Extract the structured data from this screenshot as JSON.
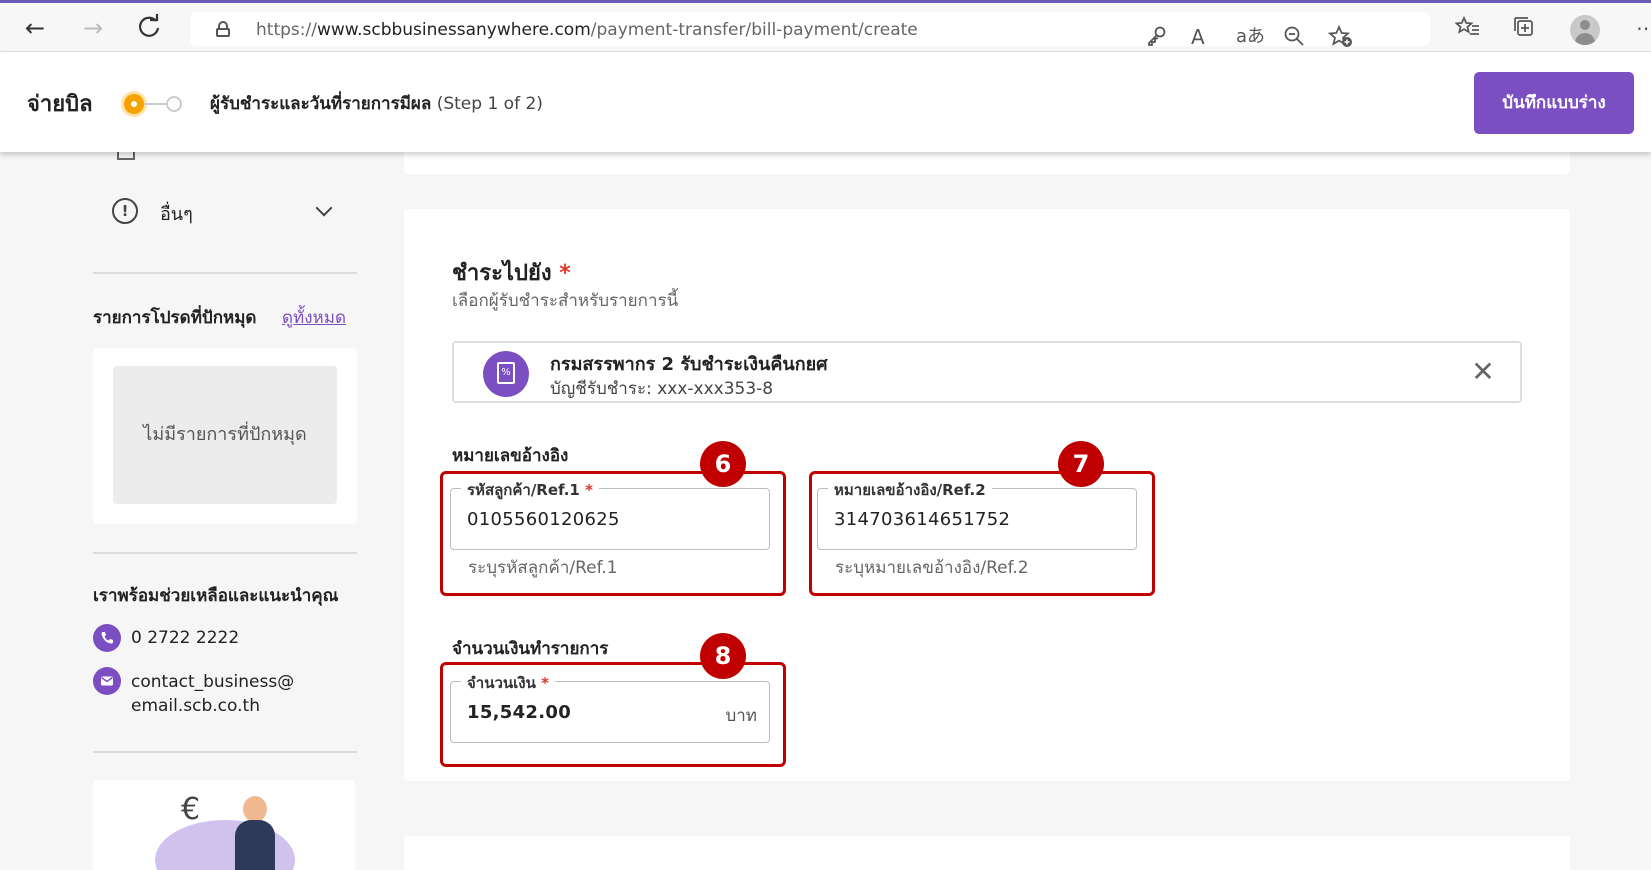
{
  "browser": {
    "back_icon": "←",
    "forward_icon": "→",
    "refresh_icon": "C",
    "url_scheme": "https://",
    "url_host": "www.scbbusinessanywhere.com",
    "url_path": "/payment-transfer/bill-payment/create",
    "icons": [
      "key-icon",
      "read-aloud-icon",
      "translate-icon",
      "zoom-out-icon",
      "favorite-add-icon",
      "favorites-icon",
      "collections-icon",
      "profile-icon",
      "more-icon"
    ],
    "read_aloud_glyph": "A",
    "translate_glyph": "aあ",
    "more_glyph": "⋯"
  },
  "header": {
    "title": "จ่ายบิล",
    "step_label": "ผู้รับชำระและวันที่รายการมีผล",
    "step_count": "(Step 1 of 2)",
    "save_draft": "บันทึกแบบร่าง",
    "step_active_color": "#f5a300",
    "accent_color": "#7b4fc2"
  },
  "sidebar": {
    "more_label": "อื่นๆ",
    "pinned_title": "รายการโปรดที่ปักหมุด",
    "pinned_view_all": "ดูทั้งหมด",
    "pinned_empty": "ไม่มีรายการที่ปักหมุด",
    "help_title": "เราพร้อมช่วยเหลือและแนะนำคุณ",
    "phone": "0 2722 2222",
    "email_line1": "contact_business@",
    "email_line2": "email.scb.co.th"
  },
  "form": {
    "pay_to_title": "ชำระไปยัง",
    "required_mark": "*",
    "pay_to_sub": "เลือกผู้รับชำระสำหรับรายการนี้",
    "biller_name": "กรมสรรพากร 2 รับชำระเงินคืนกยศ",
    "biller_account": "บัญชีรับชำระ: xxx-xxx353-8",
    "ref_section_title": "หมายเลขอ้างอิง",
    "ref1_label": "รหัสลูกค้า/Ref.1",
    "ref1_value": "0105560120625",
    "ref1_hint": "ระบุรหัสลูกค้า/Ref.1",
    "ref2_label": "หมายเลขอ้างอิง/Ref.2",
    "ref2_value": "314703614651752",
    "ref2_hint": "ระบุหมายเลขอ้างอิง/Ref.2",
    "amount_section_title": "จำนวนเงินทำรายการ",
    "amount_label": "จำนวนเงิน",
    "amount_value": "15,542.00",
    "amount_unit": "บาท"
  },
  "annotations": {
    "badge_6": "6",
    "badge_7": "7",
    "badge_8": "8",
    "highlight_color": "#c00000"
  }
}
